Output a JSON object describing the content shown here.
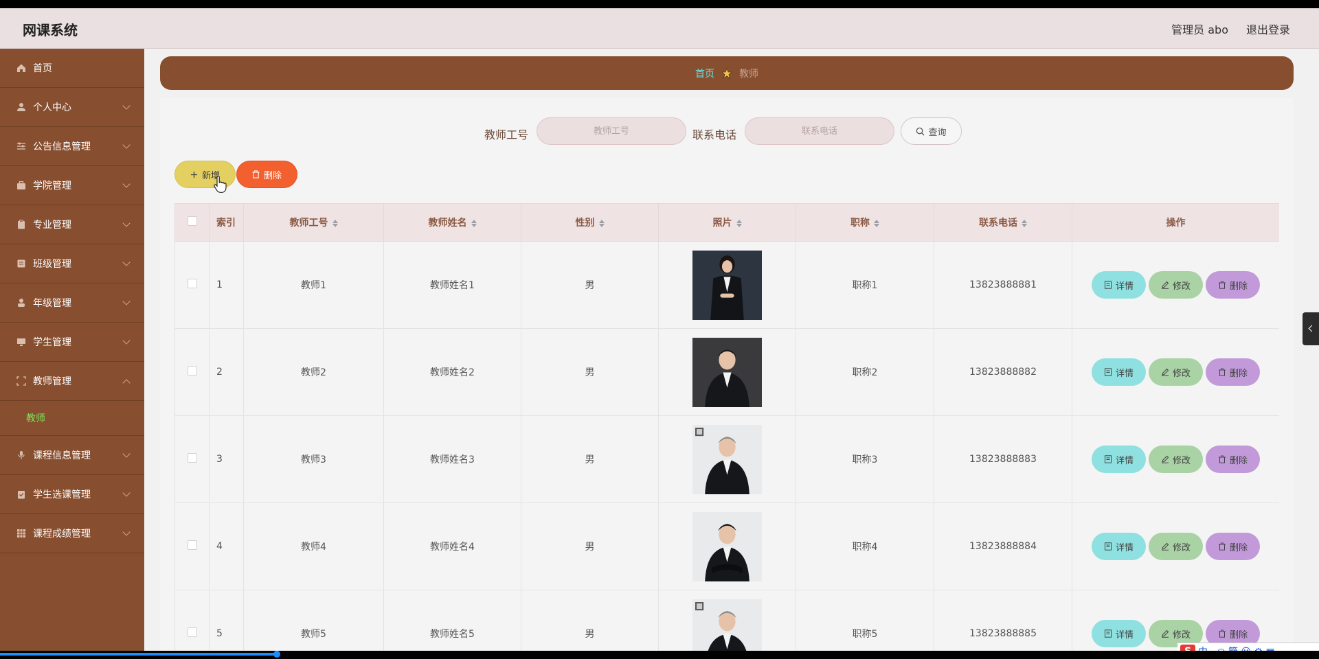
{
  "app": {
    "title": "网课系统"
  },
  "header": {
    "admin_label": "管理员 abo",
    "logout_label": "退出登录"
  },
  "sidebar": {
    "items": [
      {
        "label": "首页",
        "icon": "home-icon",
        "expandable": false
      },
      {
        "label": "个人中心",
        "icon": "user-icon",
        "expandable": true
      },
      {
        "label": "公告信息管理",
        "icon": "sliders-icon",
        "expandable": true
      },
      {
        "label": "学院管理",
        "icon": "briefcase-icon",
        "expandable": true
      },
      {
        "label": "专业管理",
        "icon": "clipboard-icon",
        "expandable": true
      },
      {
        "label": "班级管理",
        "icon": "list-icon",
        "expandable": true
      },
      {
        "label": "年级管理",
        "icon": "person-icon",
        "expandable": true
      },
      {
        "label": "学生管理",
        "icon": "monitor-icon",
        "expandable": true
      },
      {
        "label": "教师管理",
        "icon": "grid-icon",
        "expandable": true,
        "open": true,
        "children": [
          {
            "label": "教师",
            "active": true
          }
        ]
      },
      {
        "label": "课程信息管理",
        "icon": "mic-icon",
        "expandable": true
      },
      {
        "label": "学生选课管理",
        "icon": "clipboard-check-icon",
        "expandable": true
      },
      {
        "label": "课程成绩管理",
        "icon": "table-icon",
        "expandable": true
      }
    ],
    "bg_color": "#874e2f",
    "active_color": "#7ee35a"
  },
  "breadcrumb": {
    "home": "首页",
    "separator_icon": "star-icon",
    "current": "教师"
  },
  "search": {
    "field1_label": "教师工号",
    "field1_placeholder": "教师工号",
    "field2_label": "联系电话",
    "field2_placeholder": "联系电话",
    "button_label": "查询",
    "button_icon": "search-icon"
  },
  "actions": {
    "add_label": "新增",
    "add_icon": "plus-icon",
    "delete_label": "删除",
    "delete_icon": "trash-icon"
  },
  "table": {
    "columns": [
      "索引",
      "教师工号",
      "教师姓名",
      "性别",
      "照片",
      "职称",
      "联系电话",
      "操作"
    ],
    "sortable": [
      false,
      true,
      true,
      true,
      true,
      true,
      true,
      false
    ],
    "rows": [
      {
        "index": "1",
        "teacher_id": "教师1",
        "name": "教师姓名1",
        "gender": "男",
        "photo": "photo-woman-suit",
        "title": "职称1",
        "phone": "13823888881"
      },
      {
        "index": "2",
        "teacher_id": "教师2",
        "name": "教师姓名2",
        "gender": "男",
        "photo": "photo-man-dark-bg",
        "title": "职称2",
        "phone": "13823888882"
      },
      {
        "index": "3",
        "teacher_id": "教师3",
        "name": "教师姓名3",
        "gender": "男",
        "photo": "photo-man-white-bg",
        "title": "职称3",
        "phone": "13823888883"
      },
      {
        "index": "4",
        "teacher_id": "教师4",
        "name": "教师姓名4",
        "gender": "男",
        "photo": "photo-man-arms-crossed",
        "title": "职称4",
        "phone": "13823888884"
      },
      {
        "index": "5",
        "teacher_id": "教师5",
        "name": "教师姓名5",
        "gender": "男",
        "photo": "photo-man-white-bg",
        "title": "职称5",
        "phone": "13823888885"
      }
    ],
    "row_actions": {
      "detail": "详情",
      "edit": "修改",
      "delete": "删除"
    }
  },
  "video": {
    "progress_fraction": 0.21
  },
  "ime": {
    "logo": "S",
    "text": "中·, ◎ 簡 ☺ ⚙ ▦"
  }
}
